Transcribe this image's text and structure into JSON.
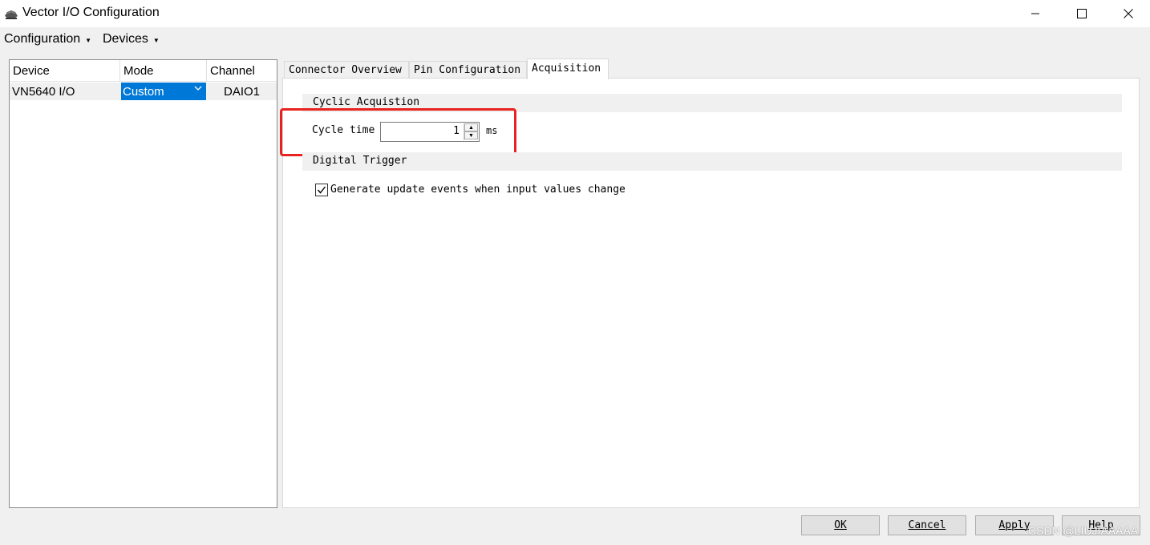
{
  "window": {
    "title": "Vector I/O Configuration",
    "icon": "vector-app-icon"
  },
  "menu": {
    "configuration": "Configuration",
    "devices": "Devices"
  },
  "device_table": {
    "headers": [
      "Device",
      "Mode",
      "Channel"
    ],
    "rows": [
      {
        "device": "VN5640 I/O",
        "mode": "Custom",
        "channel": "DAIO1"
      }
    ]
  },
  "tabs": [
    {
      "label": "Connector Overview",
      "active": false
    },
    {
      "label": "Pin Configuration",
      "active": false
    },
    {
      "label": "Acquisition",
      "active": true
    }
  ],
  "acquisition": {
    "cyclic_header": "Cyclic Acquistion",
    "cycle_time_label": "Cycle time",
    "cycle_time_value": "1",
    "cycle_time_unit": "ms",
    "digital_header": "Digital Trigger",
    "checkbox_label": "Generate update events when input values change",
    "checkbox_checked": true
  },
  "buttons": {
    "ok": "OK",
    "cancel": "Cancel",
    "apply": "Apply",
    "help": "Help"
  },
  "watermark": "CSDN @LIUJIAAAAA",
  "colors": {
    "selection": "#0078d7",
    "highlight_box": "#e8231f"
  }
}
